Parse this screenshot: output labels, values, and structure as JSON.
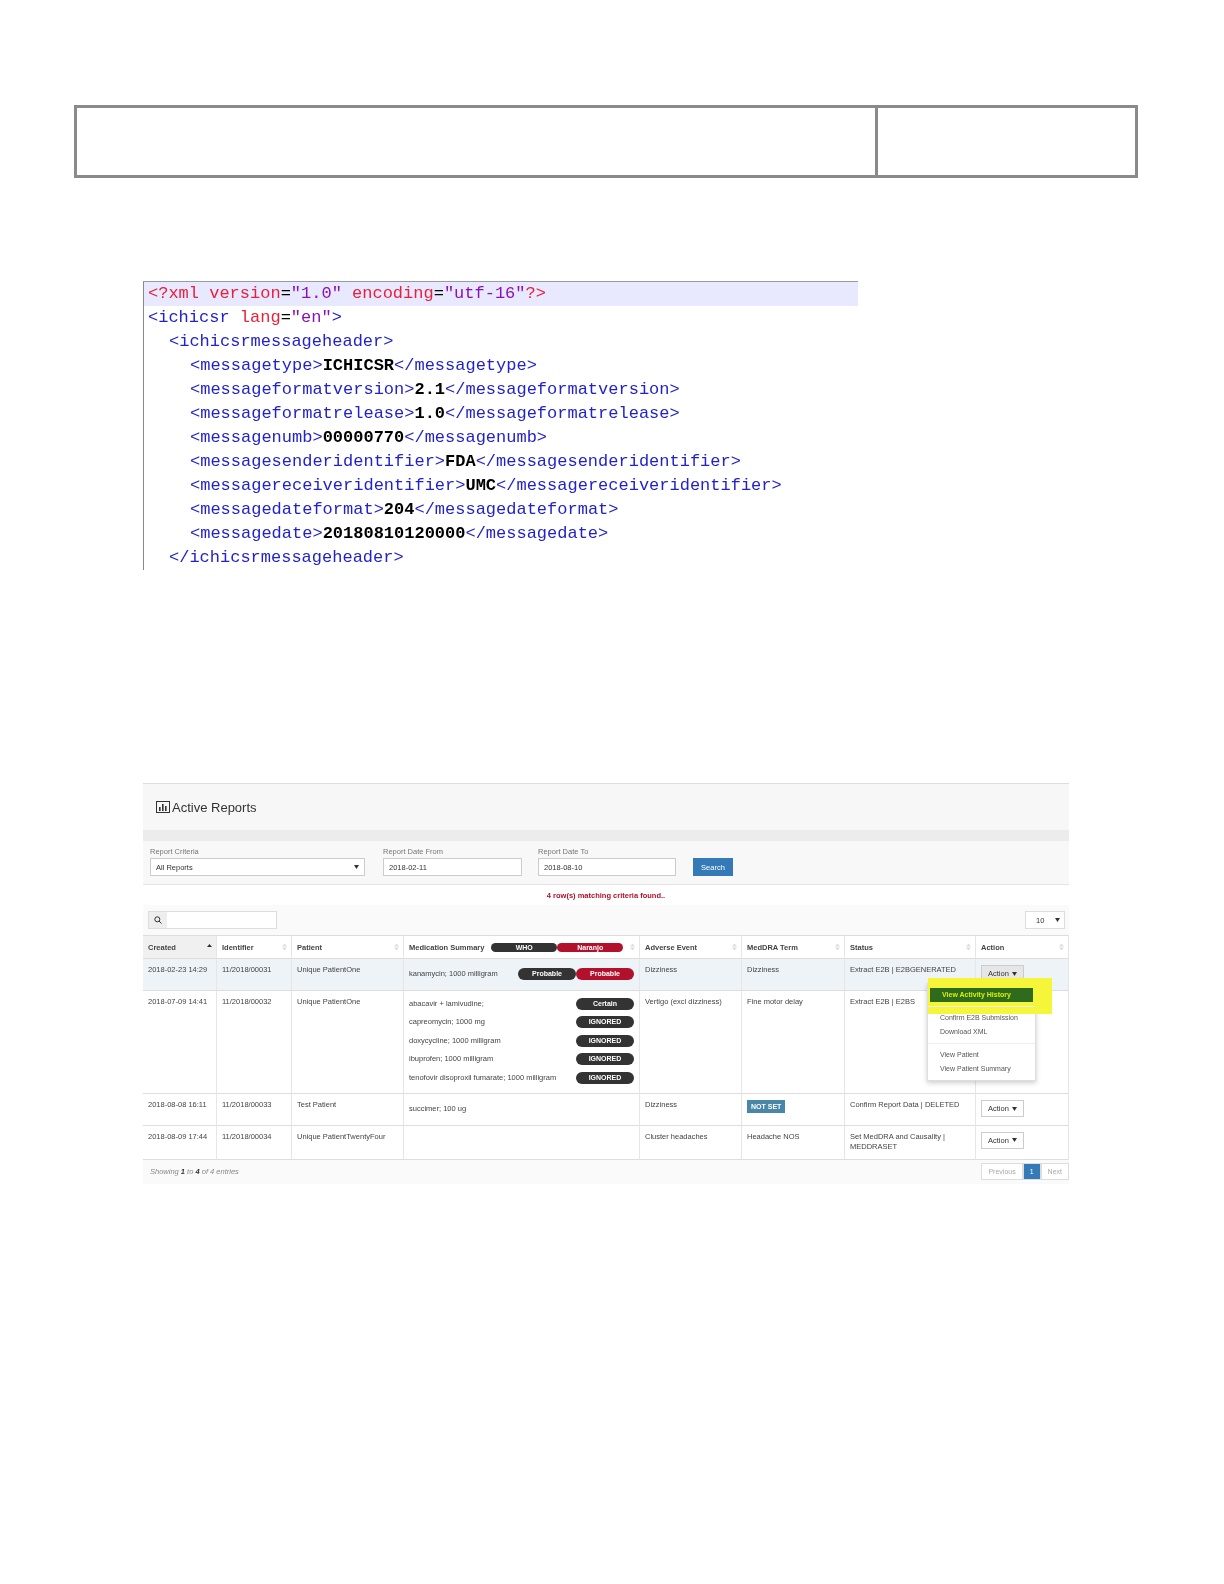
{
  "header_table": {
    "cells": [
      {
        "kind": "wide"
      },
      {
        "kind": "narrow"
      }
    ]
  },
  "xml_view": {
    "lines": [
      {
        "current": true,
        "segments": [
          {
            "kind": "decl",
            "text": "<?xml"
          },
          {
            "kind": "attr",
            "text": " version"
          },
          {
            "kind": "eq",
            "text": "="
          },
          {
            "kind": "value",
            "text": "\"1.0\""
          },
          {
            "kind": "attr",
            "text": " encoding"
          },
          {
            "kind": "eq",
            "text": "="
          },
          {
            "kind": "value",
            "text": "\"utf-16\""
          },
          {
            "kind": "decl",
            "text": "?>"
          }
        ]
      },
      {
        "current": false,
        "segments": [
          {
            "kind": "tag",
            "text": "<ichicsr"
          },
          {
            "kind": "attr",
            "text": " lang"
          },
          {
            "kind": "eq",
            "text": "="
          },
          {
            "kind": "value",
            "text": "\"en\""
          },
          {
            "kind": "tag",
            "text": ">"
          }
        ],
        "children": [
          {
            "current": false,
            "segments": [
              {
                "kind": "tag",
                "text": "<ichicsrmessageheader>"
              }
            ],
            "children": [
              {
                "current": false,
                "segments": [
                  {
                    "kind": "tag",
                    "text": "<messagetype>"
                  },
                  {
                    "kind": "text",
                    "text": "ICHICSR"
                  },
                  {
                    "kind": "tag",
                    "text": "</messagetype>"
                  }
                ]
              },
              {
                "current": false,
                "segments": [
                  {
                    "kind": "tag",
                    "text": "<messageformatversion>"
                  },
                  {
                    "kind": "text",
                    "text": "2.1"
                  },
                  {
                    "kind": "tag",
                    "text": "</messageformatversion>"
                  }
                ]
              },
              {
                "current": false,
                "segments": [
                  {
                    "kind": "tag",
                    "text": "<messageformatrelease>"
                  },
                  {
                    "kind": "text",
                    "text": "1.0"
                  },
                  {
                    "kind": "tag",
                    "text": "</messageformatrelease>"
                  }
                ]
              },
              {
                "current": false,
                "segments": [
                  {
                    "kind": "tag",
                    "text": "<messagenumb>"
                  },
                  {
                    "kind": "text",
                    "text": "00000770"
                  },
                  {
                    "kind": "tag",
                    "text": "</messagenumb>"
                  }
                ]
              },
              {
                "current": false,
                "segments": [
                  {
                    "kind": "tag",
                    "text": "<messagesenderidentifier>"
                  },
                  {
                    "kind": "text",
                    "text": "FDA"
                  },
                  {
                    "kind": "tag",
                    "text": "</messagesenderidentifier>"
                  }
                ]
              },
              {
                "current": false,
                "segments": [
                  {
                    "kind": "tag",
                    "text": "<messagereceiveridentifier>"
                  },
                  {
                    "kind": "text",
                    "text": "UMC"
                  },
                  {
                    "kind": "tag",
                    "text": "</messagereceiveridentifier>"
                  }
                ]
              },
              {
                "current": false,
                "segments": [
                  {
                    "kind": "tag",
                    "text": "<messagedateformat>"
                  },
                  {
                    "kind": "text",
                    "text": "204"
                  },
                  {
                    "kind": "tag",
                    "text": "</messagedateformat>"
                  }
                ]
              },
              {
                "current": false,
                "segments": [
                  {
                    "kind": "tag",
                    "text": "<messagedate>"
                  },
                  {
                    "kind": "text",
                    "text": "20180810120000"
                  },
                  {
                    "kind": "tag",
                    "text": "</messagedate>"
                  }
                ]
              }
            ]
          },
          {
            "current": false,
            "segments": [
              {
                "kind": "tag",
                "text": "</ichicsrmessageheader>"
              }
            ]
          }
        ]
      }
    ]
  },
  "report": {
    "title": "Active Reports",
    "filters": [
      {
        "kind": "select",
        "label": "Report Criteria",
        "value": "All Reports"
      },
      {
        "kind": "input",
        "label": "Report Date From",
        "value": "2018-02-11"
      },
      {
        "kind": "input",
        "label": "Report Date To",
        "value": "2018-08-10"
      }
    ],
    "search_button": "Search",
    "message": "4 row(s) matching criteria found..",
    "page_size": "10",
    "columns": [
      {
        "label": "Created",
        "sorted": true
      },
      {
        "label": "Identifier",
        "sorted": false
      },
      {
        "label": "Patient",
        "sorted": false
      },
      {
        "label": "Medication Summary",
        "sorted": false,
        "pills": [
          {
            "kind": "who",
            "text": "WHO"
          },
          {
            "kind": "naranjo",
            "text": "Naranjo"
          }
        ]
      },
      {
        "label": "Adverse Event",
        "sorted": false
      },
      {
        "label": "MedDRA Term",
        "sorted": false
      },
      {
        "label": "Status",
        "sorted": false
      },
      {
        "label": "Action",
        "sorted": false
      }
    ],
    "rows": [
      {
        "selected": true,
        "created": "2018-02-23 14:29",
        "identifier": "11/2018/00031",
        "patient": "Unique PatientOne",
        "medications": [
          {
            "name": "kanamycin; 1000 milligram",
            "badges": [
              {
                "kind": "who",
                "text": "Probable"
              },
              {
                "kind": "naranjo",
                "text": "Probable"
              }
            ]
          }
        ],
        "adverse_event": "Dizziness",
        "meddra": {
          "kind": "text",
          "text": "Dizziness"
        },
        "status": "Extract E2B | E2BGENERATED",
        "action": "Action",
        "menu_open": true
      },
      {
        "selected": false,
        "created": "2018-07-09 14:41",
        "identifier": "11/2018/00032",
        "patient": "Unique PatientOne",
        "medications": [
          {
            "name": "abacavir + lamivudine;",
            "badges": [
              {
                "kind": "who",
                "text": "Certain"
              }
            ]
          },
          {
            "name": "capreomycin; 1000 mg",
            "badges": [
              {
                "kind": "who",
                "text": "IGNORED"
              }
            ]
          },
          {
            "name": "doxycycline; 1000 milligram",
            "badges": [
              {
                "kind": "who",
                "text": "IGNORED"
              }
            ]
          },
          {
            "name": "ibuprofen; 1000 milligram",
            "badges": [
              {
                "kind": "who",
                "text": "IGNORED"
              }
            ]
          },
          {
            "name": "tenofovir disoproxil fumarate; 1000 milligram",
            "badges": [
              {
                "kind": "who",
                "text": "IGNORED"
              }
            ]
          }
        ],
        "adverse_event": "Vertigo (excl dizziness)",
        "meddra": {
          "kind": "text",
          "text": "Fine motor delay"
        },
        "status": "Extract E2B | E2BS"
      },
      {
        "selected": false,
        "created": "2018-08-08 16:11",
        "identifier": "11/2018/00033",
        "patient": "Test Patient",
        "medications": [
          {
            "name": "succimer; 100 ug"
          }
        ],
        "adverse_event": "Dizziness",
        "meddra": {
          "kind": "badge",
          "text": "NOT SET"
        },
        "status": "Confirm Report Data | DELETED",
        "action": "Action",
        "menu_open": false
      },
      {
        "selected": false,
        "created": "2018-08-09 17:44",
        "identifier": "11/2018/00034",
        "patient": "Unique PatientTwentyFour",
        "adverse_event": "Cluster headaches",
        "meddra": {
          "kind": "text",
          "text": "Headache NOS"
        },
        "status": "Set MedDRA and Causality | MEDDRASET",
        "action": "Action",
        "menu_open": false
      }
    ],
    "menu": [
      {
        "kind": "item",
        "text": "View Activity History",
        "highlighted": true
      },
      {
        "kind": "divider"
      },
      {
        "kind": "item",
        "text": "Confirm E2B Submission",
        "highlighted": false
      },
      {
        "kind": "item",
        "text": "Download XML",
        "highlighted": false
      },
      {
        "kind": "divider"
      },
      {
        "kind": "item",
        "text": "View Patient",
        "highlighted": false
      },
      {
        "kind": "item",
        "text": "View Patient Summary",
        "highlighted": false
      }
    ],
    "footer": "Showing **1** to **4** of *4* entries",
    "pagination": [
      {
        "text": "Previous",
        "selected": false,
        "disabled": true
      },
      {
        "text": "1",
        "selected": true,
        "disabled": false
      },
      {
        "text": "Next",
        "selected": false,
        "disabled": true
      }
    ]
  }
}
